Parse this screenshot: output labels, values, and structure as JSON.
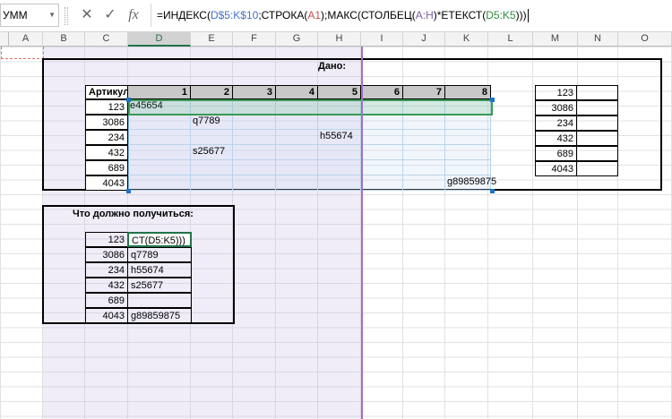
{
  "formula_bar": {
    "name_box": "УММ",
    "cancel_icon": "✕",
    "enter_icon": "✓",
    "fx_label": "fx",
    "formula_parts": [
      {
        "t": "=ИНДЕКС(",
        "c": "#000000"
      },
      {
        "t": "D$5:K$10",
        "c": "#4472c4"
      },
      {
        "t": ";СТРОКА(",
        "c": "#000000"
      },
      {
        "t": "A1",
        "c": "#c0504d"
      },
      {
        "t": ");МАКС(СТОЛБЕЦ(",
        "c": "#000000"
      },
      {
        "t": "A:H",
        "c": "#7f5aa6"
      },
      {
        "t": ")*ЕТЕКСТ(",
        "c": "#000000"
      },
      {
        "t": "D5:K5",
        "c": "#2e8b3d"
      },
      {
        "t": ")))",
        "c": "#000000"
      }
    ]
  },
  "columns": [
    "A",
    "B",
    "C",
    "D",
    "E",
    "F",
    "G",
    "H",
    "I",
    "J",
    "K",
    "L",
    "M",
    "N",
    "O"
  ],
  "selected_column": "D",
  "given": {
    "title": "Дано:",
    "header_label": "Артикул",
    "header_numbers": [
      "1",
      "2",
      "3",
      "4",
      "5",
      "6",
      "7",
      "8"
    ],
    "rows": [
      {
        "article": "123",
        "cells": [
          "e45654",
          "",
          "",
          "",
          "",
          "",
          "",
          ""
        ]
      },
      {
        "article": "3086",
        "cells": [
          "",
          "q7789",
          "",
          "",
          "",
          "",
          "",
          ""
        ]
      },
      {
        "article": "234",
        "cells": [
          "",
          "",
          "",
          "",
          "h55674",
          "",
          "",
          ""
        ]
      },
      {
        "article": "432",
        "cells": [
          "",
          "s25677",
          "",
          "",
          "",
          "",
          "",
          ""
        ]
      },
      {
        "article": "689",
        "cells": [
          "",
          "",
          "",
          "",
          "",
          "",
          "",
          ""
        ]
      },
      {
        "article": "4043",
        "cells": [
          "",
          "",
          "",
          "",
          "",
          "",
          "",
          "g89859875"
        ]
      }
    ],
    "side_list": [
      "123",
      "3086",
      "234",
      "432",
      "689",
      "4043"
    ]
  },
  "expected": {
    "title": "Что должно получиться:",
    "rows": [
      {
        "article": "123",
        "value": "CT(D5:K5)))"
      },
      {
        "article": "3086",
        "value": "q7789"
      },
      {
        "article": "234",
        "value": "h55674"
      },
      {
        "article": "432",
        "value": "s25677"
      },
      {
        "article": "689",
        "value": ""
      },
      {
        "article": "4043",
        "value": "g89859875"
      }
    ]
  },
  "colors": {
    "excel_green": "#217346",
    "purple_range": "#9b72c8",
    "blue_range": "#4472c4",
    "green_range": "#3a9a55"
  }
}
